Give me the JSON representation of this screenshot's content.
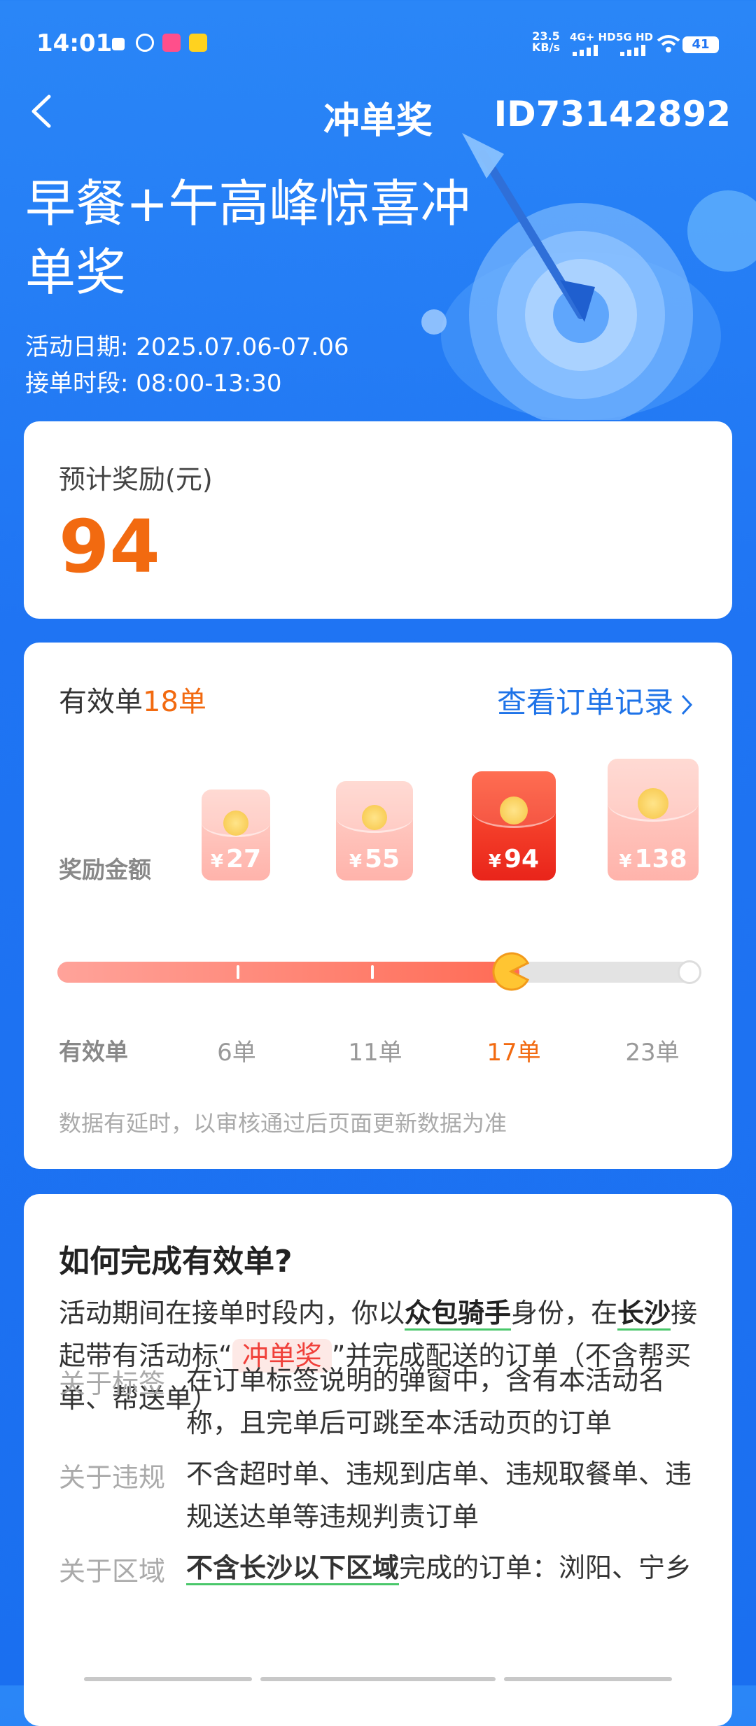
{
  "status_bar": {
    "time": "14:01",
    "net_speed": "23.5 KB/s",
    "sim1": "4G+ HD",
    "sim2": "5G HD",
    "battery": "41"
  },
  "header": {
    "title": "冲单奖",
    "id": "ID73142892"
  },
  "hero": {
    "title": "早餐+午高峰惊喜冲单奖",
    "date_line": "活动日期: 2025.07.06-07.06",
    "time_line": "接单时段: 08:00-13:30"
  },
  "reward": {
    "label": "预计奖励(元)",
    "value": "94"
  },
  "progress": {
    "valid_prefix": "有效单",
    "valid_count": "18单",
    "view_records": "查看订单记录",
    "award_label": "奖励金额",
    "order_label": "有效单",
    "tiers": [
      {
        "amount": "27",
        "orders": "6单",
        "active": false
      },
      {
        "amount": "55",
        "orders": "11单",
        "active": false
      },
      {
        "amount": "94",
        "orders": "17单",
        "active": true
      },
      {
        "amount": "138",
        "orders": "23单",
        "active": false
      }
    ],
    "currency": "¥",
    "progress_fraction": 0.78,
    "note": "数据有延时，以审核通过后页面更新数据为准"
  },
  "howto": {
    "title": "如何完成有效单?",
    "p1": "活动期间在接单时段内，你以",
    "p1_rider": "众包骑手",
    "p1_mid": "身份，在",
    "p1_city": "长沙",
    "p1_mid2": "接起带有活动标“",
    "p1_tag": "冲单奖",
    "p1_end": "”并完成配送的订单（不含帮买单、帮送单）",
    "rows": [
      {
        "label": "关于标签",
        "text": "在订单标签说明的弹窗中，含有本活动名称，且完单后可跳至本活动页的订单"
      },
      {
        "label": "关于违规",
        "text": "不含超时单、违规到店单、违规取餐单、违规送达单等违规判责订单"
      },
      {
        "label": "关于区域",
        "text_strong": "不含长沙以下区域",
        "text": "完成的订单：浏阳、宁乡"
      }
    ]
  }
}
